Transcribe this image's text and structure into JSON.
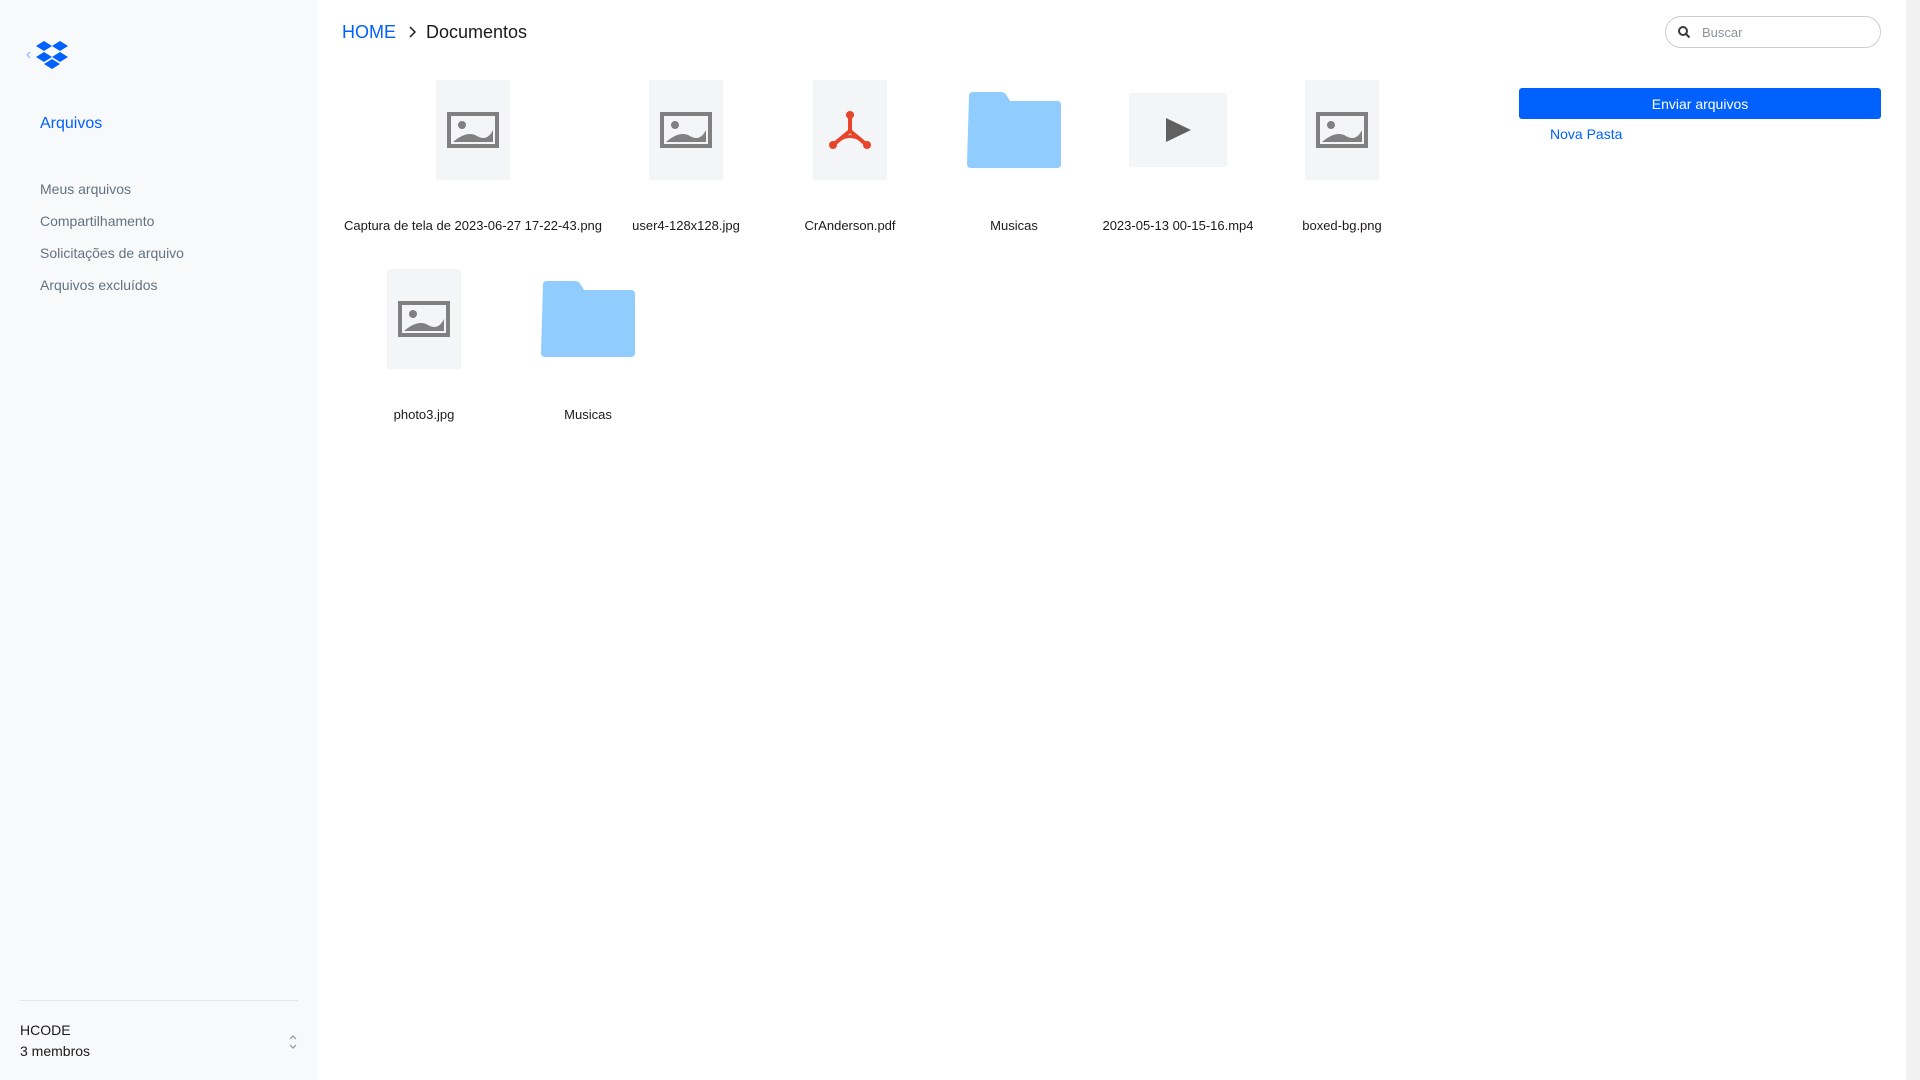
{
  "sidebar": {
    "back_glyph": "‹",
    "section_title": "Arquivos",
    "nav": [
      "Meus arquivos",
      "Compartilhamento",
      "Solicitações de arquivo",
      "Arquivos excluídos"
    ],
    "team": {
      "name": "HCODE",
      "members": "3 membros"
    }
  },
  "breadcrumb": {
    "home": "HOME",
    "current": "Documentos"
  },
  "search": {
    "placeholder": "Buscar"
  },
  "actions": {
    "upload": "Enviar arquivos",
    "new_folder": "Nova Pasta"
  },
  "files": [
    {
      "name": "Captura de tela de 2023-06-27 17-22-43.png",
      "icon": "image-icon"
    },
    {
      "name": "user4-128x128.jpg",
      "icon": "image-icon"
    },
    {
      "name": "CrAnderson.pdf",
      "icon": "pdf-icon"
    },
    {
      "name": "Musicas",
      "icon": "folder-icon"
    },
    {
      "name": "2023-05-13 00-15-16.mp4",
      "icon": "video-icon"
    },
    {
      "name": "boxed-bg.png",
      "icon": "image-icon"
    },
    {
      "name": "photo3.jpg",
      "icon": "image-icon"
    },
    {
      "name": "Musicas",
      "icon": "folder-icon"
    }
  ],
  "colors": {
    "accent": "#0061fe",
    "folder": "#90cdfe",
    "pdf": "#e8442a",
    "icon_gray": "#808080"
  }
}
